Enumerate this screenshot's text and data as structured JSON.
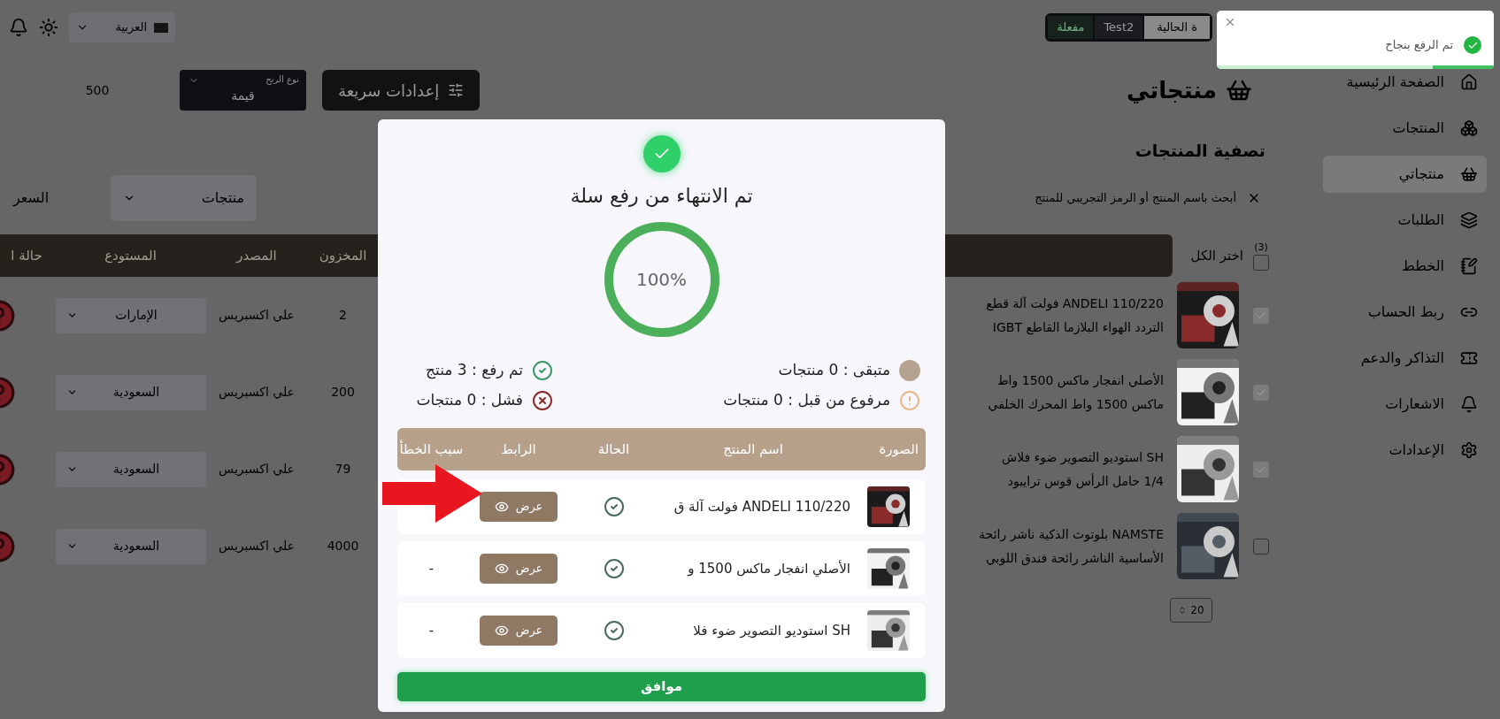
{
  "topbar": {
    "language": "العربية",
    "store": {
      "label": "ة الحالية",
      "name": "Test2",
      "status": "مفعلة"
    }
  },
  "toast": {
    "message": "تم الرفع بنجاح",
    "level": 0.22
  },
  "sidebar": {
    "items": [
      {
        "label": "الصفحة الرئيسية",
        "selected": false
      },
      {
        "label": "المنتجات",
        "selected": false
      },
      {
        "label": "منتجاتي",
        "selected": true
      },
      {
        "label": "الطلبات",
        "selected": false
      },
      {
        "label": "الخطط",
        "selected": false
      },
      {
        "label": "ربط الحساب",
        "selected": false
      },
      {
        "label": "التذاكر والدعم",
        "selected": false
      },
      {
        "label": "الاشعارات",
        "selected": false
      },
      {
        "label": "الإعدادات",
        "selected": false
      }
    ]
  },
  "page": {
    "title": "منتجاتي",
    "quick_settings": "إعدادات سريعة",
    "profit_type": {
      "label": "نوع الربح",
      "value": "قيمة"
    },
    "profit_value": "500"
  },
  "filters": {
    "title": "تصفية المنتجات",
    "search_placeholder": "أبحث باسم المنتج أو الرمز التجريبي للمنتج",
    "type_select": "منتجات",
    "price_label": "السعر"
  },
  "products_table": {
    "select_all": {
      "label": "اختر الكل",
      "count": "(3)",
      "checked": false
    },
    "columns": [
      "المخزون",
      "المصدر",
      "المستودع",
      "حالة ا"
    ],
    "rows": [
      {
        "checked": true,
        "name_lines": [
          "ANDELI 110/220 فولت آلة قطع",
          "التردد الهواء البلازما القاطع IGBT"
        ],
        "stock": "2",
        "source": "علي اكسبريس",
        "warehouse": "الإمارات"
      },
      {
        "checked": true,
        "name_lines": [
          "الأصلي انفجار ماكس 1500 واط",
          "ماكس 1500 واط المحرك الخلفي"
        ],
        "stock": "200",
        "source": "علي اكسبريس",
        "warehouse": "السعودية"
      },
      {
        "checked": true,
        "name_lines": [
          "SH استوديو التصوير ضوء فلاش",
          "1/4 حامل الرأس قوس ترايبود"
        ],
        "stock": "79",
        "source": "علي اكسبريس",
        "warehouse": "السعودية"
      },
      {
        "checked": false,
        "name_lines": [
          "NAMSTE بلوتوث الذكية ناشر رائحة",
          "الأساسية الناشر رائحة فندق اللوبي"
        ],
        "stock": "4000",
        "source": "علي اكسبريس",
        "warehouse": "السعودية"
      }
    ]
  },
  "pagination": {
    "page_size": "20"
  },
  "upload_dialog": {
    "title": "تم الانتهاء من رفع سلة",
    "progress": {
      "level": 1,
      "label": "100%"
    },
    "stats": [
      {
        "kind": "remaining",
        "text": "متبقى : 0 منتجات"
      },
      {
        "kind": "uploaded",
        "text": "تم رفع : 3 منتج"
      },
      {
        "kind": "already",
        "text": "مرفوع من قبل : 0 منتجات"
      },
      {
        "kind": "failed",
        "text": "فشل : 0 منتجات"
      }
    ],
    "columns": [
      "الصورة",
      "اسم المنتج",
      "الحالة",
      "الرابط",
      "سبب الخطأ"
    ],
    "rows": [
      {
        "name": "ANDELI 110/220 فولت آلة ق",
        "success": true,
        "link": "عرض"
      },
      {
        "name": "الأصلي انفجار ماكس 1500 و",
        "success": true,
        "link": "عرض",
        "error": "-"
      },
      {
        "name": "SH استوديو التصوير ضوء فلا",
        "success": true,
        "link": "عرض",
        "error": "-"
      }
    ],
    "ok_button": "موافق"
  }
}
